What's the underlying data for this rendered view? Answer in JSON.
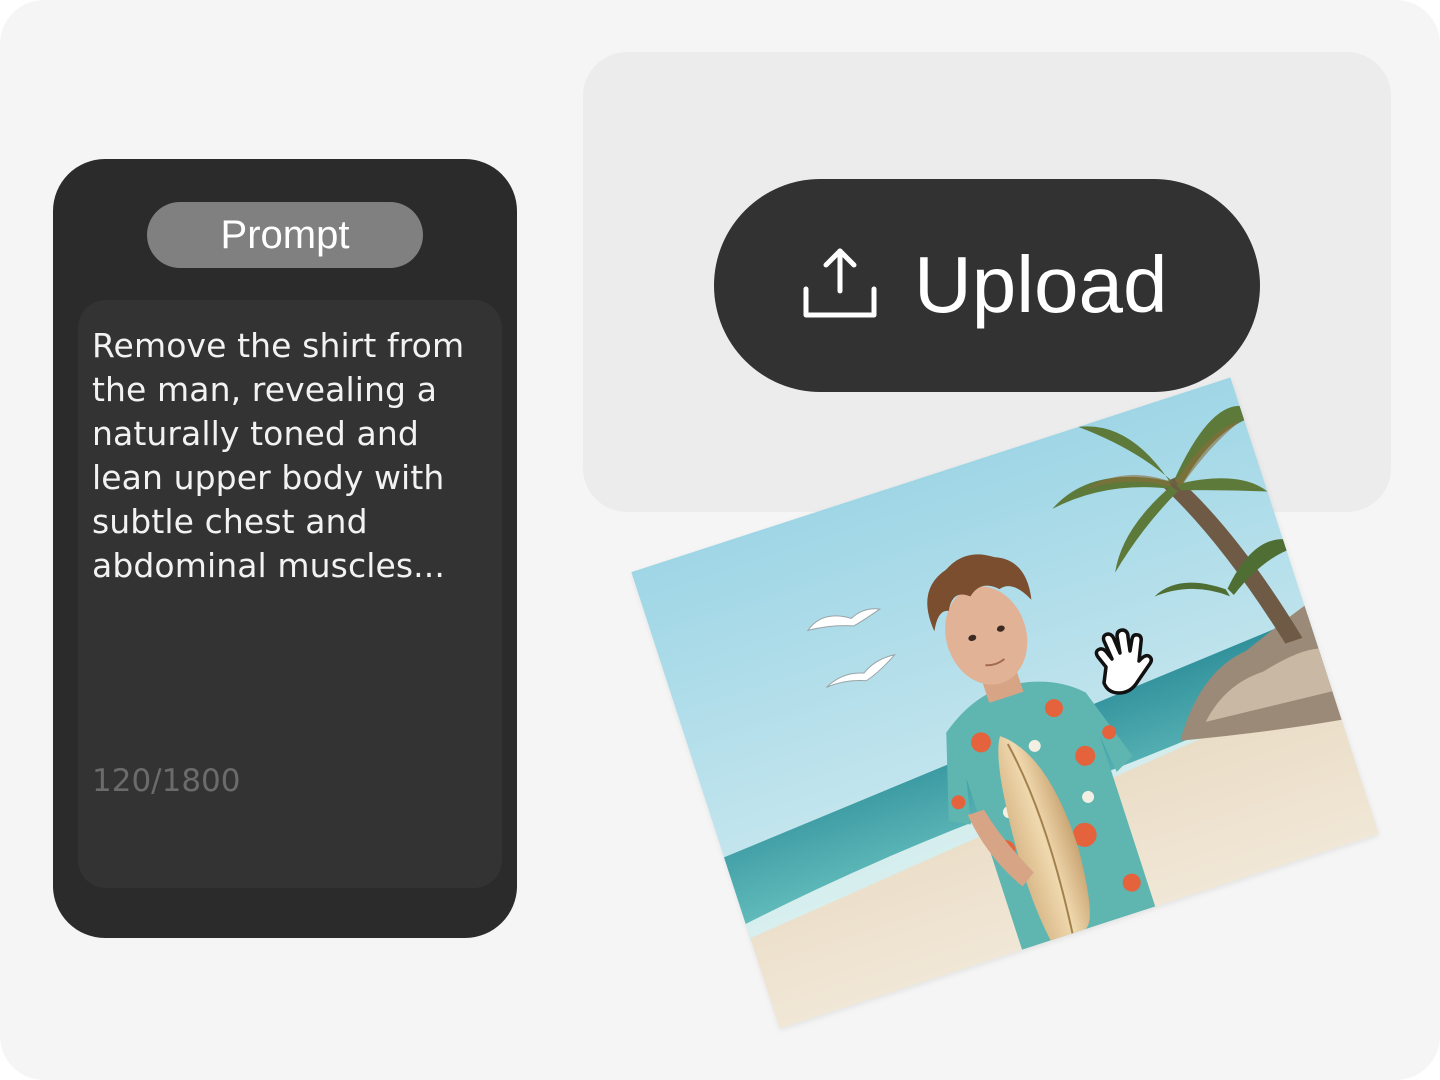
{
  "prompt": {
    "title": "Prompt",
    "text": "Remove the shirt from the man, revealing a naturally toned and lean upper body with subtle chest and abdominal muscles...",
    "char_count": "120/1800"
  },
  "upload": {
    "label": "Upload",
    "icon": "upload-icon"
  },
  "photo": {
    "subject": "Young man with curly hair in a floral shirt holding a surfboard on a beach with palm trees and seagulls"
  },
  "cursor": {
    "icon": "hand-cursor-icon"
  },
  "colors": {
    "background": "#f5f5f5",
    "panel": "#2b2b2b",
    "pill": "#808080",
    "text_box": "#333333",
    "upload_zone": "#ececec",
    "upload_button": "#323232",
    "muted_text": "#6b6b6b"
  }
}
